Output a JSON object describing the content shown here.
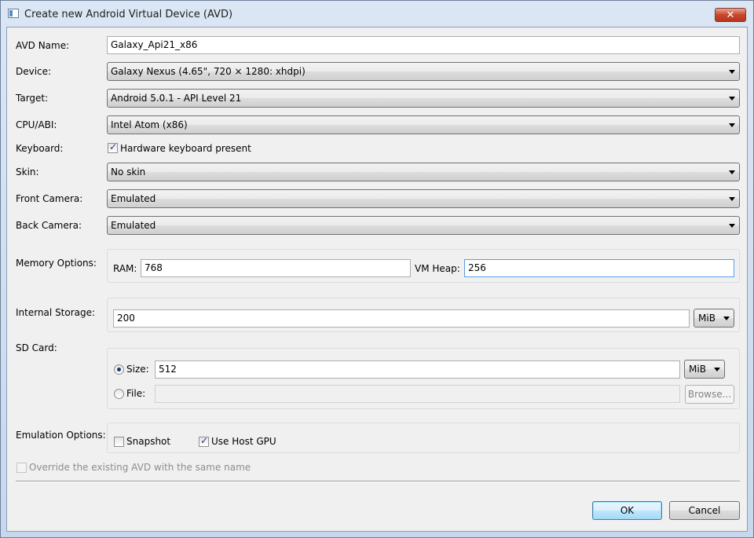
{
  "window": {
    "title": "Create new Android Virtual Device (AVD)",
    "close_glyph": "✕"
  },
  "avd_name": {
    "label": "AVD Name:",
    "value": "Galaxy_Api21_x86"
  },
  "device": {
    "label": "Device:",
    "value": "Galaxy Nexus (4.65\", 720 × 1280: xhdpi)"
  },
  "target": {
    "label": "Target:",
    "value": "Android 5.0.1 - API Level 21"
  },
  "cpu_abi": {
    "label": "CPU/ABI:",
    "value": "Intel Atom (x86)"
  },
  "keyboard": {
    "label": "Keyboard:",
    "checkbox_label": "Hardware keyboard present",
    "checked": true
  },
  "skin": {
    "label": "Skin:",
    "value": "No skin"
  },
  "front_camera": {
    "label": "Front Camera:",
    "value": "Emulated"
  },
  "back_camera": {
    "label": "Back Camera:",
    "value": "Emulated"
  },
  "memory": {
    "label": "Memory Options:",
    "ram_label": "RAM:",
    "ram_value": "768",
    "vm_heap_label": "VM Heap:",
    "vm_heap_value": "256"
  },
  "internal_storage": {
    "label": "Internal Storage:",
    "value": "200",
    "unit": "MiB"
  },
  "sd_card": {
    "label": "SD Card:",
    "size_label": "Size:",
    "size_value": "512",
    "size_unit": "MiB",
    "size_selected": true,
    "file_label": "File:",
    "file_value": "",
    "browse_label": "Browse..."
  },
  "emulation": {
    "label": "Emulation Options:",
    "snapshot_label": "Snapshot",
    "snapshot_checked": false,
    "host_gpu_label": "Use Host GPU",
    "host_gpu_checked": true
  },
  "override": {
    "label": "Override the existing AVD with the same name",
    "checked": false
  },
  "buttons": {
    "ok": "OK",
    "cancel": "Cancel"
  },
  "colors": {
    "title_gradient_top": "#dbe6f4",
    "client_bg": "#f0f0f0",
    "close_red": "#c8462c",
    "focus_border": "#569de5"
  }
}
